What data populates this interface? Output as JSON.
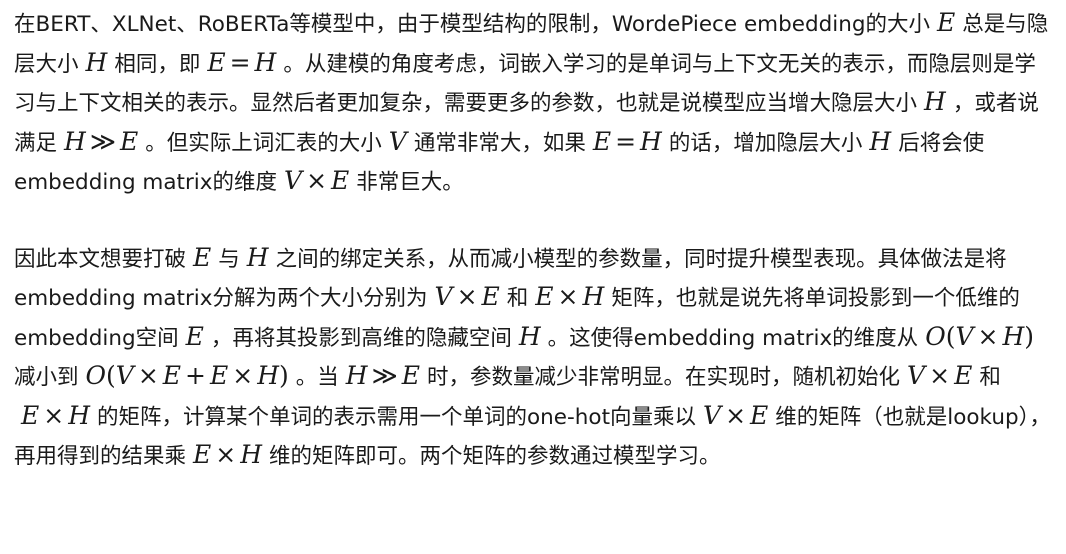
{
  "paragraphs": [
    {
      "id": "p1",
      "segments": [
        {
          "t": "text",
          "v": "在BERT、XLNet、RoBERTa等模型中，由于模型结构的限制，WordePiece embedding的大小"
        },
        {
          "t": "math",
          "v": "E"
        },
        {
          "t": "text",
          "v": "总是与隐层大小"
        },
        {
          "t": "math",
          "v": "H"
        },
        {
          "t": "text",
          "v": "相同，即"
        },
        {
          "t": "math",
          "v": "E = H"
        },
        {
          "t": "text",
          "v": "。从建模的角度考虑，词嵌入学习的是单词与上下文无关的表示，而隐层则是学习与上下文相关的表示。显然后者更加复杂，需要更多的参数，也就是说模型应当增大隐层大小"
        },
        {
          "t": "math",
          "v": "H"
        },
        {
          "t": "text",
          "v": "，或者说满足"
        },
        {
          "t": "math",
          "v": "H ≫ E"
        },
        {
          "t": "text",
          "v": "。但实际上词汇表的大小"
        },
        {
          "t": "math",
          "v": "V"
        },
        {
          "t": "text",
          "v": "通常非常大，如果"
        },
        {
          "t": "math",
          "v": "E = H"
        },
        {
          "t": "text",
          "v": "的话，增加隐层大小"
        },
        {
          "t": "math",
          "v": "H"
        },
        {
          "t": "text",
          "v": "后将会使embedding matrix的维度"
        },
        {
          "t": "math",
          "v": "V × E"
        },
        {
          "t": "text",
          "v": "非常巨大。"
        }
      ]
    },
    {
      "id": "p2",
      "segments": [
        {
          "t": "text",
          "v": "因此本文想要打破"
        },
        {
          "t": "math",
          "v": "E"
        },
        {
          "t": "text",
          "v": "与"
        },
        {
          "t": "math",
          "v": "H"
        },
        {
          "t": "text",
          "v": "之间的绑定关系，从而减小模型的参数量，同时提升模型表现。具体做法是将embedding matrix分解为两个大小分别为"
        },
        {
          "t": "math",
          "v": "V × E"
        },
        {
          "t": "text",
          "v": "和"
        },
        {
          "t": "math",
          "v": "E × H"
        },
        {
          "t": "text",
          "v": "矩阵，也就是说先将单词投影到一个低维的embedding空间"
        },
        {
          "t": "math",
          "v": "E"
        },
        {
          "t": "text",
          "v": "，再将其投影到高维的隐藏空间"
        },
        {
          "t": "math",
          "v": "H"
        },
        {
          "t": "text",
          "v": "。这使得embedding matrix的维度从"
        },
        {
          "t": "math",
          "v": "O(V × H)"
        },
        {
          "t": "text",
          "v": "减小到"
        },
        {
          "t": "math",
          "v": "O(V × E + E × H)"
        },
        {
          "t": "text",
          "v": "。当"
        },
        {
          "t": "math",
          "v": "H ≫ E"
        },
        {
          "t": "text",
          "v": "时，参数量减少非常明显。在实现时，随机初始化"
        },
        {
          "t": "math",
          "v": "V × E"
        },
        {
          "t": "text",
          "v": "和"
        },
        {
          "t": "math",
          "v": "E × H"
        },
        {
          "t": "text",
          "v": "的矩阵，计算某个单词的表示需用一个单词的one-hot向量乘以"
        },
        {
          "t": "math",
          "v": "V × E"
        },
        {
          "t": "text",
          "v": "维的矩阵（也就是lookup），再用得到的结果乘"
        },
        {
          "t": "math",
          "v": "E × H"
        },
        {
          "t": "text",
          "v": "维的矩阵即可。两个矩阵的参数通过模型学习。"
        }
      ]
    }
  ]
}
